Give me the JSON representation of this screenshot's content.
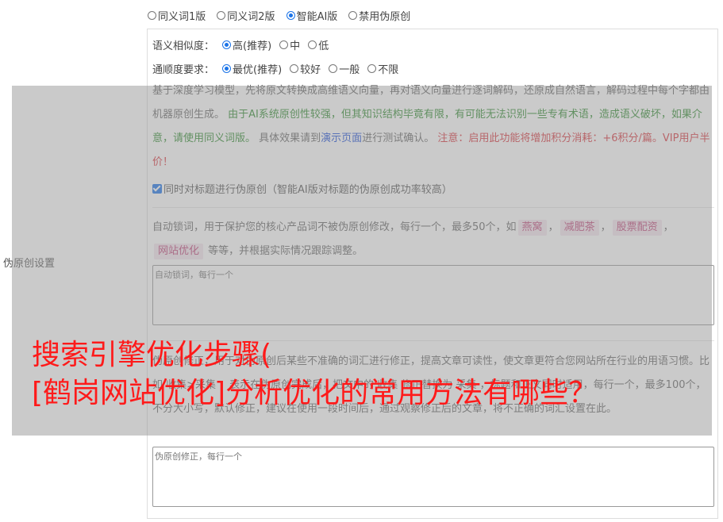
{
  "row_label": "伪原创设置",
  "modes": [
    {
      "label": "同义词1版",
      "checked": false
    },
    {
      "label": "同义词2版",
      "checked": false
    },
    {
      "label": "智能AI版",
      "checked": true
    },
    {
      "label": "禁用伪原创",
      "checked": false
    }
  ],
  "similarity": {
    "label": "语义相似度：",
    "options": [
      {
        "label": "高(推荐)",
        "checked": true
      },
      {
        "label": "中",
        "checked": false
      },
      {
        "label": "低",
        "checked": false
      }
    ]
  },
  "fluency": {
    "label": "通顺度要求：",
    "options": [
      {
        "label": "最优(推荐)",
        "checked": true
      },
      {
        "label": "较好",
        "checked": false
      },
      {
        "label": "一般",
        "checked": false
      },
      {
        "label": "不限",
        "checked": false
      }
    ]
  },
  "desc": {
    "part1": "基于深度学习模型，先将原文转换成高维语义向量，再对语义向量进行逐词解码，还原成自然语言，解码过程中每个字都由机器原创生成。",
    "green": "由于AI系统原创性较强，但其知识结构毕竟有限，有可能无法识别一些专有术语，造成语义破坏，如果介意，请使用同义词版。",
    "part2": "具体效果请到",
    "link": "演示页面",
    "part3": "进行测试确认。",
    "red": "注意：启用此功能将增加积分消耗：+6积分/篇。VIP用户半价！"
  },
  "title_check": {
    "label": "同时对标题进行伪原创（智能AI版对标题的伪原创成功率较高）",
    "checked": true
  },
  "lock": {
    "intro": "自动锁词，用于保护您的核心产品词不被伪原创修改，每行一个，最多50个，如",
    "tags": [
      "燕窝",
      "减肥茶",
      "股票配资",
      "网站优化"
    ],
    "sep": "，",
    "outro": "等等，并根据实际情况跟踪调整。",
    "placeholder": "自动锁词，每行一个"
  },
  "correct": {
    "text": "伪原创修正，用于对伪原创后某些不准确的词汇进行修正，提高文章可读性，使文章更符合您网站所在行业的用语习惯。比如 收集>采集 ，表示在伪原创完成后，把文中的 收集 修正替换为 采集 ，标题和正文同时适用，每行一个，最多100个，不分大小写，默认修正，建议在使用一段时间后，通过观察修正后的文章，将不正确的词汇设置在此。",
    "placeholder": "伪原创修正，每行一个"
  },
  "headline": {
    "line1": "搜索引擎优化步骤(",
    "line2": "[鹤岗网站优化]分析优化的常用方法有哪些？"
  }
}
